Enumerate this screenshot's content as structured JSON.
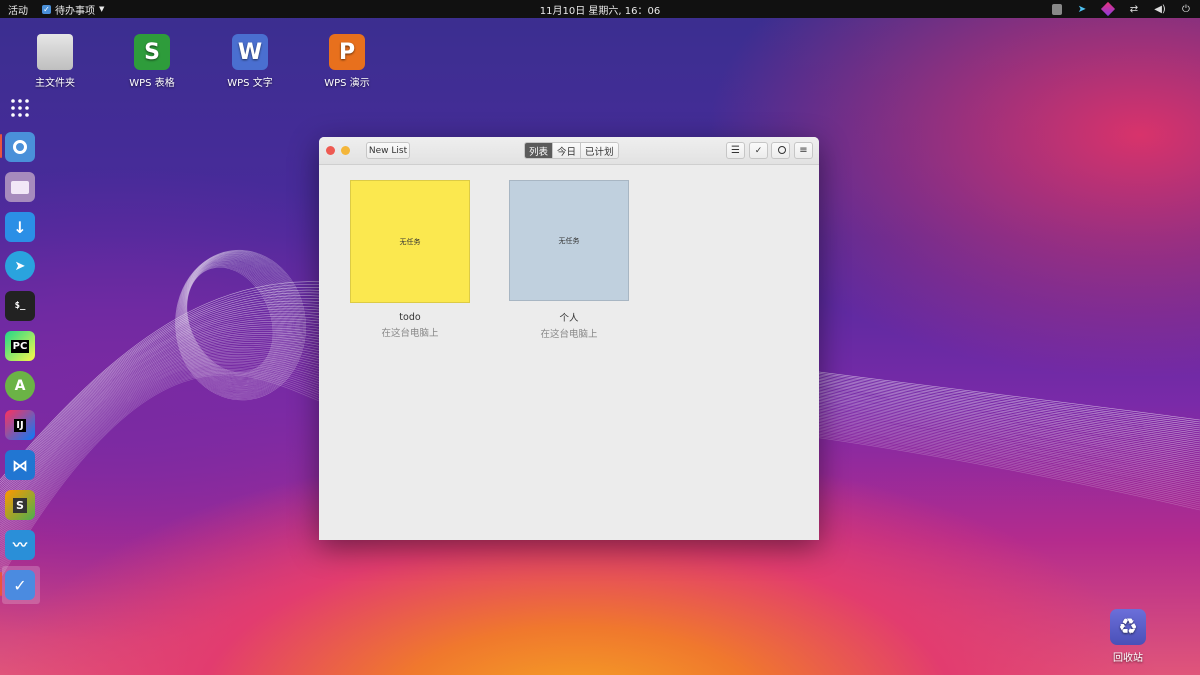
{
  "topbar": {
    "activities": "活动",
    "app_menu": "待办事项",
    "clock": "11月10日 星期六, 16：06"
  },
  "desktop_icons": [
    {
      "label": "主文件夹",
      "icon": "folder-icon"
    },
    {
      "label": "WPS 表格",
      "icon": "wps-spreadsheet-icon",
      "glyph": "S",
      "color": "#2e9c3b"
    },
    {
      "label": "WPS 文字",
      "icon": "wps-writer-icon",
      "glyph": "W",
      "color": "#4a6fd0"
    },
    {
      "label": "WPS 演示",
      "icon": "wps-presentation-icon",
      "glyph": "P",
      "color": "#e8701d"
    }
  ],
  "dock": [
    {
      "name": "app-grid-icon"
    },
    {
      "name": "chrome-icon",
      "color": "#4a90d9",
      "running": true
    },
    {
      "name": "files-icon",
      "color": "#a68bbd"
    },
    {
      "name": "download-icon",
      "color": "#2b8fe6"
    },
    {
      "name": "telegram-icon",
      "color": "#2aa3de"
    },
    {
      "name": "terminal-icon",
      "color": "#222222"
    },
    {
      "name": "pycharm-icon",
      "color": "#1f8a3a"
    },
    {
      "name": "android-studio-icon",
      "color": "#6bb346"
    },
    {
      "name": "intellij-icon",
      "color": "#111111"
    },
    {
      "name": "vscode-icon",
      "color": "#2176d2"
    },
    {
      "name": "sublime-icon",
      "color": "#e8942a"
    },
    {
      "name": "monitor-icon",
      "color": "#2a8fd8"
    },
    {
      "name": "todo-icon",
      "color": "#4b8be0",
      "active": true
    }
  ],
  "window": {
    "new_list_button": "New List",
    "tabs": [
      "列表",
      "今日",
      "已计划"
    ],
    "active_tab": "列表",
    "lists": [
      {
        "name": "todo",
        "location": "在这台电脑上",
        "preview": "无任务",
        "color": "#fbe84f"
      },
      {
        "name": "个人",
        "location": "在这台电脑上",
        "preview": "无任务",
        "color": "#c0d0de"
      }
    ]
  },
  "trash": {
    "label": "回收站"
  },
  "colors": {
    "close": "#ee5a52",
    "minimize": "#f4b63a"
  }
}
